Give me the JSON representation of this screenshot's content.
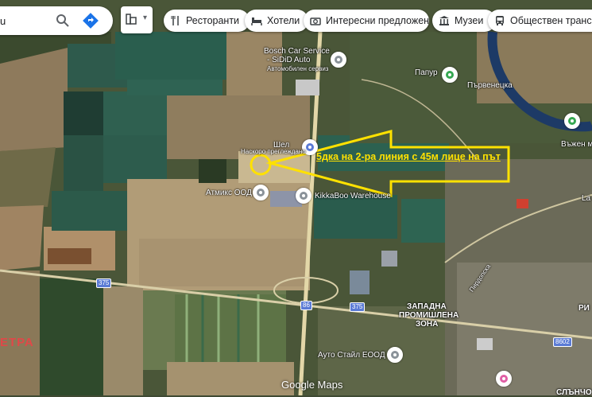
{
  "search": {
    "value": "u"
  },
  "chips": [
    {
      "label": "Ресторанти",
      "icon": "fork-knife-icon"
    },
    {
      "label": "Хотели",
      "icon": "bed-icon"
    },
    {
      "label": "Интересни предложени",
      "icon": "camera-icon"
    },
    {
      "label": "Музеи",
      "icon": "museum-icon"
    },
    {
      "label": "Обществен транспо",
      "icon": "bus-icon"
    }
  ],
  "places": {
    "bosch": "Bosch Car Service",
    "sidid": "- SiDiD Auto",
    "bosch_sub": "Автомобилен сервиз",
    "shell": "Шел",
    "naskoro": "Наскоро преглеждано",
    "atmiks": "Атмикс ООД",
    "kikkaboo": "KikkaBoo Warehouse",
    "papur": "Папур",
    "parvenetska": "Първенецка",
    "vazhen": "Въжен м",
    "zapadna1": "ЗАПАДНА",
    "zapadna2": "ПРОМИШЛЕНА",
    "zapadna3": "ЗОНА",
    "auto_stail": "Ауто Стайл ЕООД",
    "ri": "РИ",
    "sl": "СЛЪНЧО",
    "la": "La",
    "street": "Пирдопска",
    "red": "ЕТРА"
  },
  "routes": {
    "r375a": "375",
    "r375b": "375",
    "r86": "86",
    "r8602": "8602"
  },
  "callout": "5дка на 2-ра линия с 45м лице на път",
  "watermark": "Google Maps",
  "colors": {
    "callout": "#ffe100",
    "route": "#5b7bd5"
  }
}
